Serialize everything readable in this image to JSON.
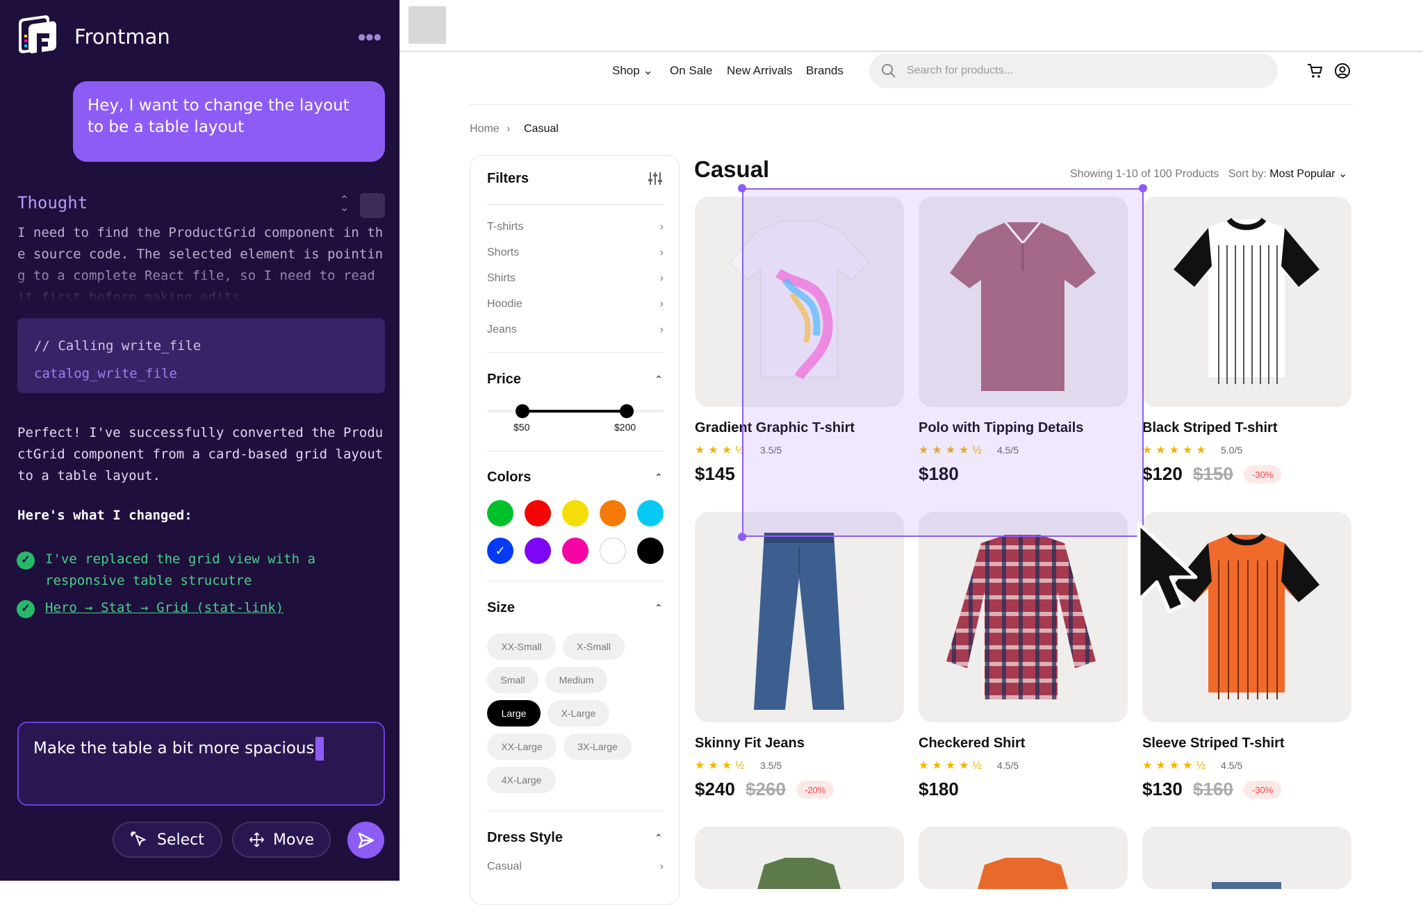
{
  "sidebar": {
    "app_name": "Frontman",
    "user_message": "Hey, I want to change the layout to be a table layout",
    "thought_title": "Thought",
    "thought_text": "I need to find the ProductGrid component in the source code. The selected element is pointing to a complete React file, so I need to read it first before making edits.",
    "code_comment": "// Calling write_file",
    "code_fn": "catalog_write_file",
    "reply": "Perfect! I've successfully converted the ProductGrid component from a card-based grid layout to a table layout.",
    "changes_heading": "Here's what I changed:",
    "changes": [
      "I've replaced the grid view with a responsive table strucutre",
      "Hero → Stat → Grid (stat-link)"
    ],
    "input_value": "Make the table a bit more spacious",
    "select_label": "Select",
    "move_label": "Move"
  },
  "shop": {
    "nav": [
      "Shop",
      "On Sale",
      "New Arrivals",
      "Brands"
    ],
    "search_placeholder": "Search for products...",
    "breadcrumb": [
      "Home",
      "Casual"
    ],
    "filters": {
      "title": "Filters",
      "categories": [
        "T-shirts",
        "Shorts",
        "Shirts",
        "Hoodie",
        "Jeans"
      ],
      "price_title": "Price",
      "price_min": "$50",
      "price_max": "$200",
      "colors_title": "Colors",
      "colors": [
        "#00c12b",
        "#f50606",
        "#f5dd06",
        "#f57906",
        "#06caf5",
        "#063af5",
        "#7d06f5",
        "#f506a4",
        "#ffffff",
        "#000000"
      ],
      "selected_color": "#063af5",
      "size_title": "Size",
      "sizes": [
        "XX-Small",
        "X-Small",
        "Small",
        "Medium",
        "Large",
        "X-Large",
        "XX-Large",
        "3X-Large",
        "4X-Large"
      ],
      "selected_size": "Large",
      "dress_title": "Dress Style",
      "dress_first": "Casual"
    },
    "title": "Casual",
    "showing": "Showing 1-10 of 100 Products",
    "sort_label": "Sort by:",
    "sort_value": "Most Popular",
    "products": [
      {
        "name": "Gradient Graphic T-shirt",
        "rating": "3.5/5",
        "stars": "★★★½",
        "price": "$145",
        "old": "",
        "disc": ""
      },
      {
        "name": "Polo with Tipping Details",
        "rating": "4.5/5",
        "stars": "★★★★½",
        "price": "$180",
        "old": "",
        "disc": ""
      },
      {
        "name": "Black Striped T-shirt",
        "rating": "5.0/5",
        "stars": "★★★★★",
        "price": "$120",
        "old": "$150",
        "disc": "-30%"
      },
      {
        "name": "Skinny Fit Jeans",
        "rating": "3.5/5",
        "stars": "★★★½",
        "price": "$240",
        "old": "$260",
        "disc": "-20%"
      },
      {
        "name": "Checkered Shirt",
        "rating": "4.5/5",
        "stars": "★★★★½",
        "price": "$180",
        "old": "",
        "disc": ""
      },
      {
        "name": "Sleeve Striped T-shirt",
        "rating": "4.5/5",
        "stars": "★★★★½",
        "price": "$130",
        "old": "$160",
        "disc": "-30%"
      }
    ]
  }
}
